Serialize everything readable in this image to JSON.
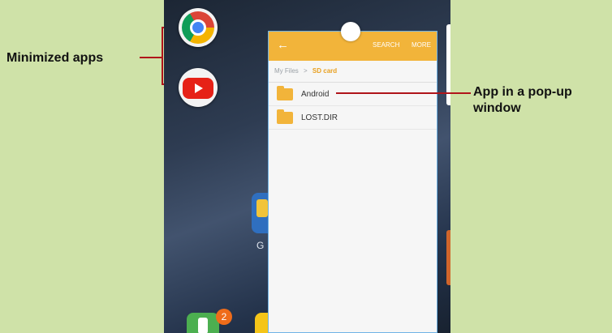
{
  "callouts": {
    "minimized": "Minimized apps",
    "popup": "App in a pop-up window"
  },
  "popup": {
    "header": {
      "back_icon": "←",
      "search": "SEARCH",
      "more": "MORE"
    },
    "breadcrumb": {
      "root": "My Files",
      "separator": ">",
      "current": "SD card"
    },
    "files": [
      {
        "name": "Android"
      },
      {
        "name": "LOST.DIR"
      }
    ]
  },
  "home": {
    "google_folder_label": "G",
    "phone_badge": "2"
  },
  "colors": {
    "background": "#cfe2a8",
    "callout_line": "#b0141a",
    "popup_header": "#f2b43a"
  }
}
